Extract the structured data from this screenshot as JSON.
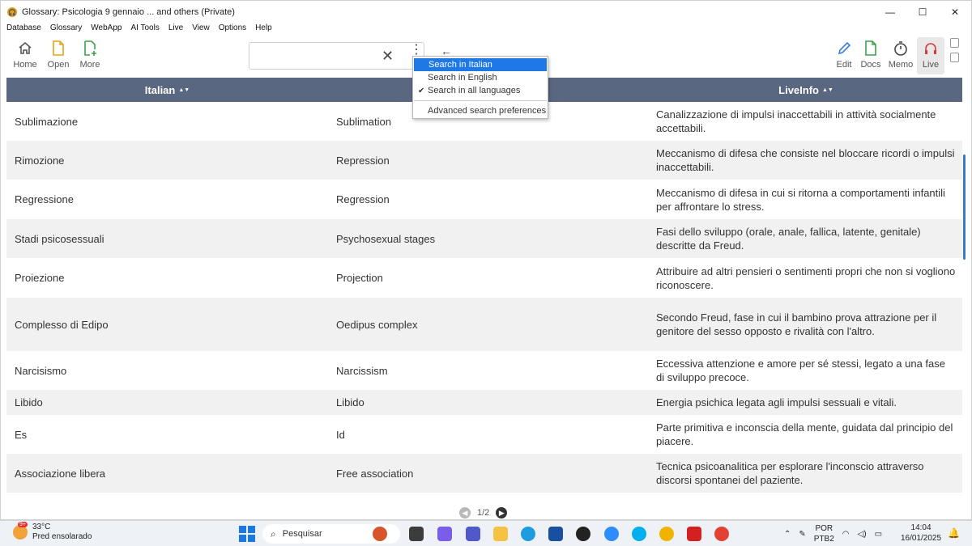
{
  "window": {
    "title": "Glossary: Psicologia 9 gennaio ... and others (Private)",
    "controls": {
      "minimize": "—",
      "maximize": "☐",
      "close": "✕"
    }
  },
  "menu": [
    "Database",
    "Glossary",
    "WebApp",
    "AI Tools",
    "Live",
    "View",
    "Options",
    "Help"
  ],
  "toolbar": {
    "home": "Home",
    "open": "Open",
    "more": "More",
    "edit": "Edit",
    "docs": "Docs",
    "memo": "Memo",
    "live": "Live",
    "search_value": ""
  },
  "dropdown": {
    "items": [
      "Search in Italian",
      "Search in English",
      "Search in all languages"
    ],
    "selected_index": 0,
    "checked_index": 2,
    "advanced": "Advanced search preferences"
  },
  "table": {
    "headers": [
      "Italian",
      "",
      "LiveInfo"
    ],
    "rows": [
      [
        "Sublimazione",
        "Sublimation",
        "Canalizzazione di impulsi inaccettabili in attività socialmente accettabili."
      ],
      [
        "Rimozione",
        "Repression",
        "Meccanismo di difesa che consiste nel bloccare ricordi o impulsi inaccettabili."
      ],
      [
        "Regressione",
        "Regression",
        "Meccanismo di difesa in cui si ritorna a comportamenti infantili per affrontare lo stress."
      ],
      [
        "Stadi psicosessuali",
        "Psychosexual stages",
        "Fasi dello sviluppo (orale, anale, fallica, latente, genitale) descritte da Freud."
      ],
      [
        "Proiezione",
        "Projection",
        "Attribuire ad altri pensieri o sentimenti propri che non si vogliono riconoscere."
      ],
      [
        "Complesso di Edipo",
        "Oedipus complex",
        "Secondo Freud, fase in cui il bambino prova attrazione per il genitore del sesso opposto e rivalità con l'altro."
      ],
      [
        "Narcisismo",
        "Narcissism",
        "Eccessiva attenzione e amore per sé stessi, legato a una fase di sviluppo precoce."
      ],
      [
        "Libido",
        "Libido",
        "Energia psichica legata agli impulsi sessuali e vitali."
      ],
      [
        "Es",
        "Id",
        "Parte primitiva e inconscia della mente, guidata dal principio del piacere."
      ],
      [
        "Associazione libera",
        "Free association",
        "Tecnica psicoanalitica per esplorare l'inconscio attraverso discorsi spontanei del paziente."
      ]
    ]
  },
  "pager": {
    "text": "1/2"
  },
  "taskbar": {
    "weather_badge": "9+",
    "temperature": "33°C",
    "weather_desc": "Pred ensolarado",
    "search_placeholder": "Pesquisar",
    "lang_line1": "POR",
    "lang_line2": "PTB2",
    "time": "14:04",
    "date": "16/01/2025"
  },
  "colors": {
    "header_bg": "#5a6780",
    "accent": "#1e78e6",
    "home_icon": "#555555",
    "open_icon": "#e8a317",
    "more_icon": "#3aa34a",
    "edit_icon": "#3b7dd8",
    "docs_icon": "#3aa34a",
    "live_icon": "#d93a3a"
  }
}
